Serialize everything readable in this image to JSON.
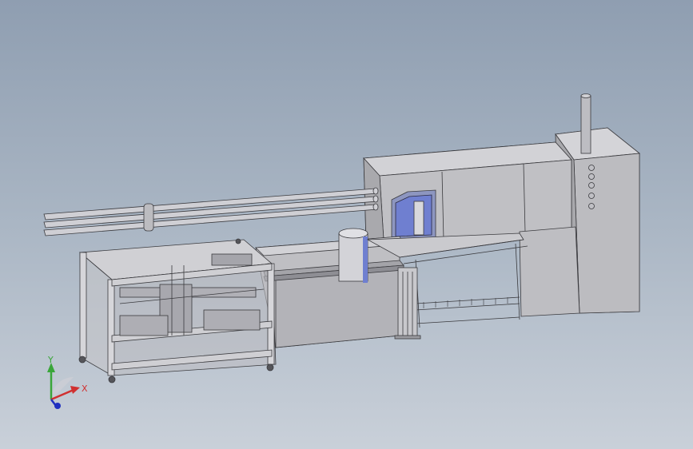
{
  "viewport": {
    "background_top": "#8f9eb1",
    "background_bottom": "#c9d0d9"
  },
  "triad": {
    "y_label": "Y",
    "x_label": "X",
    "y_color": "#3aa63a",
    "x_color": "#d03030",
    "z_color": "#2030c0"
  },
  "model": {
    "body_color": "#c8c8cc",
    "edge_color": "#3a3a3e",
    "window_color": "#6f7fd0",
    "buttons": [
      "panel-button",
      "panel-button",
      "panel-button",
      "panel-button",
      "panel-button"
    ]
  }
}
